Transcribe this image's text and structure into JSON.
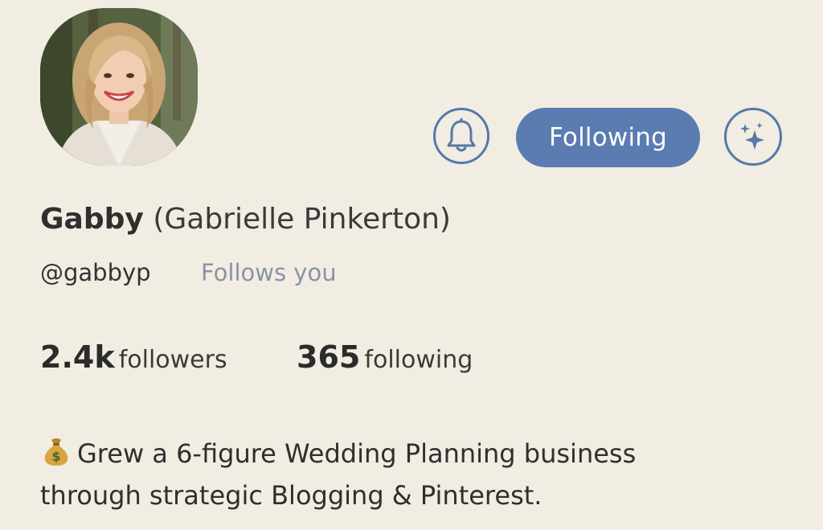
{
  "profile": {
    "display_name": "Gabby",
    "full_name": "(Gabrielle Pinkerton)",
    "handle": "@gabbyp",
    "follows_you": "Follows you",
    "avatar_icon": "profile-photo"
  },
  "actions": {
    "notify_icon": "bell-icon",
    "following_label": "Following",
    "extra_icon": "sparkle-icon",
    "accent_color": "#5a7cb1"
  },
  "stats": {
    "followers_count": "2.4k",
    "followers_label": "followers",
    "following_count": "365",
    "following_label": "following"
  },
  "bio": {
    "emoji_icon": "money-bag-icon",
    "line1": "Grew a 6-figure Wedding Planning business",
    "line2": "through strategic Blogging & Pinterest."
  }
}
